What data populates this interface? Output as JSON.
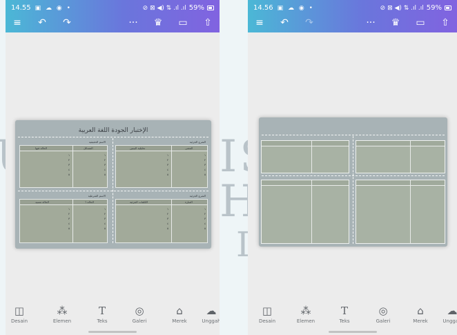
{
  "watermark": {
    "left": "U",
    "right_top": "IS",
    "right_mid": "H",
    "right_bot": "I"
  },
  "left_phone": {
    "status": {
      "time": "14.55",
      "battery": "59%"
    },
    "design": {
      "title": "الإختبار الجودة اللغة العربية",
      "quadrants": [
        {
          "section": "الاسم الحقيقية",
          "headers": [
            "الحالة فيها",
            "المسائل"
          ]
        },
        {
          "section": "الشرع الجزئية",
          "headers": [
            "المعنى",
            "تحليلية البيتين"
          ]
        },
        {
          "section": "الاسم الشرطية",
          "headers": [
            "الحالة مسيد",
            "الحالة ٦"
          ]
        },
        {
          "section": "الشرع الجزئية",
          "headers": [
            "العبارة",
            "الكلمات الجزئية"
          ]
        }
      ]
    }
  },
  "right_phone": {
    "status": {
      "time": "14.56",
      "battery": "59%"
    }
  },
  "nav": {
    "items": [
      {
        "label": "Desain",
        "icon": "design-icon"
      },
      {
        "label": "Elemen",
        "icon": "elements-icon"
      },
      {
        "label": "Teks",
        "icon": "text-icon"
      },
      {
        "label": "Galeri",
        "icon": "gallery-icon"
      },
      {
        "label": "Merek",
        "icon": "brand-icon"
      },
      {
        "label": "Unggah",
        "icon": "upload-icon"
      }
    ]
  },
  "colors": {
    "topbar_gradient": [
      "#4bb8d6",
      "#6a76dc",
      "#8163e0"
    ],
    "canvas": "#ececec",
    "design_bg": "#a8b3b6"
  }
}
